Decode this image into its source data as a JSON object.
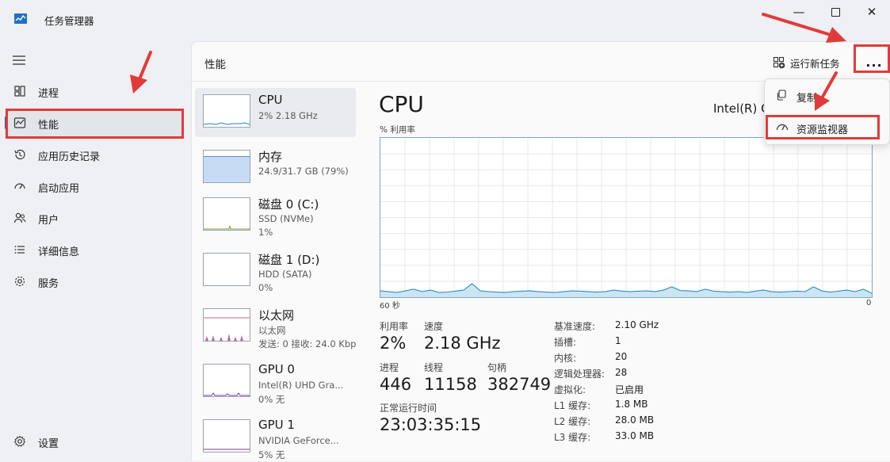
{
  "window": {
    "title": "任务管理器"
  },
  "sidebar": {
    "items": [
      {
        "label": "进程",
        "icon": "processes-icon"
      },
      {
        "label": "性能",
        "icon": "performance-icon",
        "active": true
      },
      {
        "label": "应用历史记录",
        "icon": "history-icon"
      },
      {
        "label": "启动应用",
        "icon": "startup-icon"
      },
      {
        "label": "用户",
        "icon": "users-icon"
      },
      {
        "label": "详细信息",
        "icon": "details-icon"
      },
      {
        "label": "服务",
        "icon": "services-icon"
      }
    ],
    "settings_label": "设置"
  },
  "header": {
    "title": "性能",
    "run_new_task": "运行新任务",
    "more_label": "..."
  },
  "resources": [
    {
      "name": "CPU",
      "sub1": "2% 2.18 GHz",
      "sub2": "",
      "selected": true
    },
    {
      "name": "内存",
      "sub1": "24.9/31.7 GB (79%)",
      "sub2": ""
    },
    {
      "name": "磁盘 0 (C:)",
      "sub1": "SSD (NVMe)",
      "sub2": "1%"
    },
    {
      "name": "磁盘 1 (D:)",
      "sub1": "HDD (SATA)",
      "sub2": "0%"
    },
    {
      "name": "以太网",
      "sub1": "以太网",
      "sub2": "发送: 0 接收: 24.0 Kbp"
    },
    {
      "name": "GPU 0",
      "sub1": "Intel(R) UHD Gra...",
      "sub2": "0% 无"
    },
    {
      "name": "GPU 1",
      "sub1": "NVIDIA GeForce...",
      "sub2": "5% 无"
    }
  ],
  "memory_fill_fraction": 0.79,
  "detail": {
    "title": "CPU",
    "model": "Intel(R) C",
    "util_label": "% 利用率",
    "x_left": "60 秒",
    "x_right": "0",
    "stats": {
      "utilization_label": "利用率",
      "utilization": "2%",
      "speed_label": "速度",
      "speed": "2.18 GHz",
      "processes_label": "进程",
      "processes": "446",
      "threads_label": "线程",
      "threads": "11158",
      "handles_label": "句柄",
      "handles": "382749",
      "uptime_label": "正常运行时间",
      "uptime": "23:03:35:15"
    },
    "specs": [
      {
        "label": "基准速度:",
        "value": "2.10 GHz"
      },
      {
        "label": "插槽:",
        "value": "1"
      },
      {
        "label": "内核:",
        "value": "20"
      },
      {
        "label": "逻辑处理器:",
        "value": "28"
      },
      {
        "label": "虚拟化:",
        "value": "已启用"
      },
      {
        "label": "L1 缓存:",
        "value": "1.8 MB"
      },
      {
        "label": "L2 缓存:",
        "value": "28.0 MB"
      },
      {
        "label": "L3 缓存:",
        "value": "33.0 MB"
      }
    ]
  },
  "cpu_history_percent": [
    4,
    3.5,
    3,
    4,
    5,
    3.5,
    4.5,
    3,
    3.2,
    3.8,
    4.5,
    8.5,
    4,
    3.5,
    3.2,
    3,
    3.5,
    3.8,
    4,
    3.5,
    3.2,
    3,
    3.5,
    4,
    3.8,
    3.5,
    3.2,
    3.5,
    4.5,
    3.8,
    3.5,
    3.8,
    4,
    3.5,
    4.5,
    6.5,
    4.2,
    4,
    3.5,
    5,
    3.8,
    3.5,
    3.2,
    3.5,
    3,
    3.8,
    4.5,
    3.5,
    3.2,
    3.5,
    3.8,
    3.5,
    6.5,
    4,
    3.2,
    3.8,
    4.5,
    3.5,
    5,
    2.5
  ],
  "menu": {
    "items": [
      {
        "label": "复制",
        "icon": "copy-icon"
      },
      {
        "label": "资源监视器",
        "icon": "gauge-icon"
      }
    ]
  },
  "colors": {
    "cpu_line": "#1a84c6",
    "cpu_fill": "#cde4f3",
    "memory_fill": "#c7dcf4",
    "memory_line": "#5a8bc6",
    "disk_line": "#7a9a3a",
    "ethernet_line": "#a33a6a",
    "gpu_line": "#7a3aa3",
    "annotation": "#e23a3a",
    "accent": "#1f5fb4"
  }
}
